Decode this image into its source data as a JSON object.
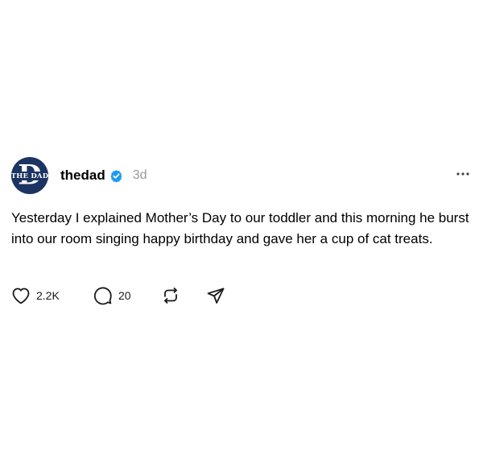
{
  "post": {
    "username": "thedad",
    "verified": true,
    "time": "3d",
    "avatar_text": "THE DAD",
    "avatar_letter": "D",
    "text": "Yesterday I explained Mother’s Day to our toddler and this morning he burst into our room singing happy birthday and gave her a cup of cat treats.",
    "likes": "2.2K",
    "replies": "20"
  },
  "icons": {
    "like": "heart-icon",
    "reply": "comment-icon",
    "repost": "repost-icon",
    "share": "send-icon",
    "more": "more-dots-icon",
    "verified": "verified-badge-icon"
  },
  "colors": {
    "avatar_bg": "#1c3461",
    "verified": "#1d9bf0",
    "timestamp": "#999999"
  }
}
